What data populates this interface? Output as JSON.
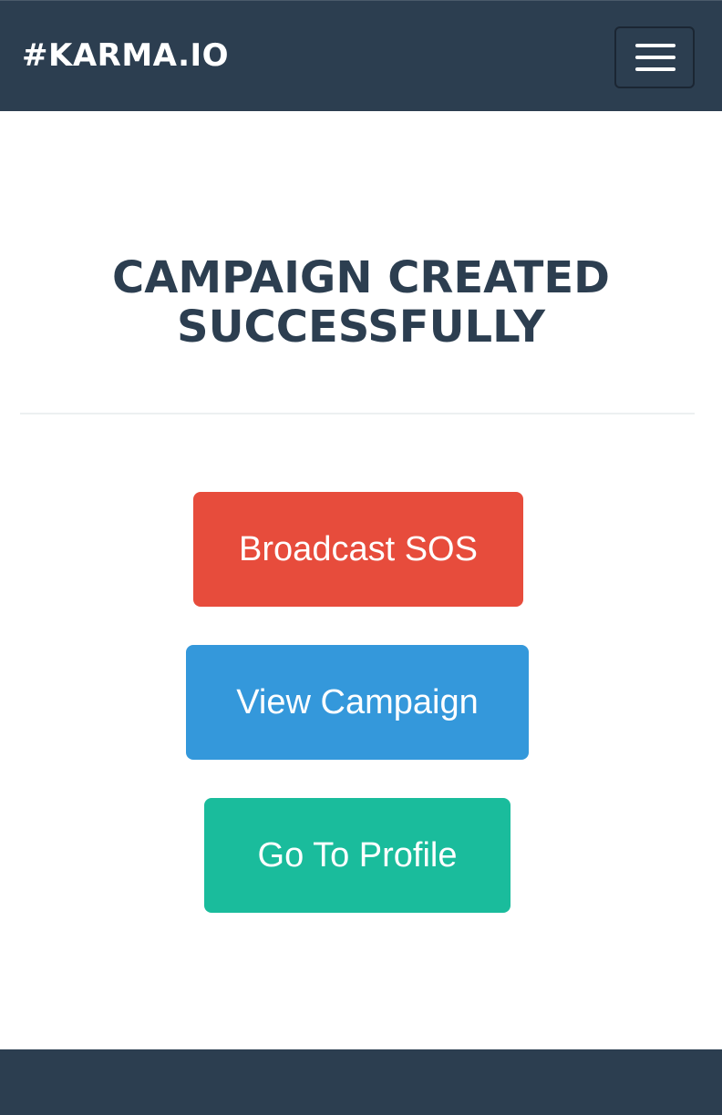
{
  "navbar": {
    "brand": "#KARMA.IO",
    "menu_icon": "hamburger-menu-icon"
  },
  "main": {
    "title_line1": "CAMPAIGN CREATED",
    "title_line2": "SUCCESSFULLY",
    "buttons": {
      "broadcast": "Broadcast SOS",
      "view_campaign": "View Campaign",
      "profile": "Go To Profile"
    }
  },
  "colors": {
    "navbar": "#2c3e50",
    "title": "#2c3e50",
    "broadcast": "#e74c3c",
    "view_campaign": "#3498db",
    "profile": "#1abc9c"
  }
}
